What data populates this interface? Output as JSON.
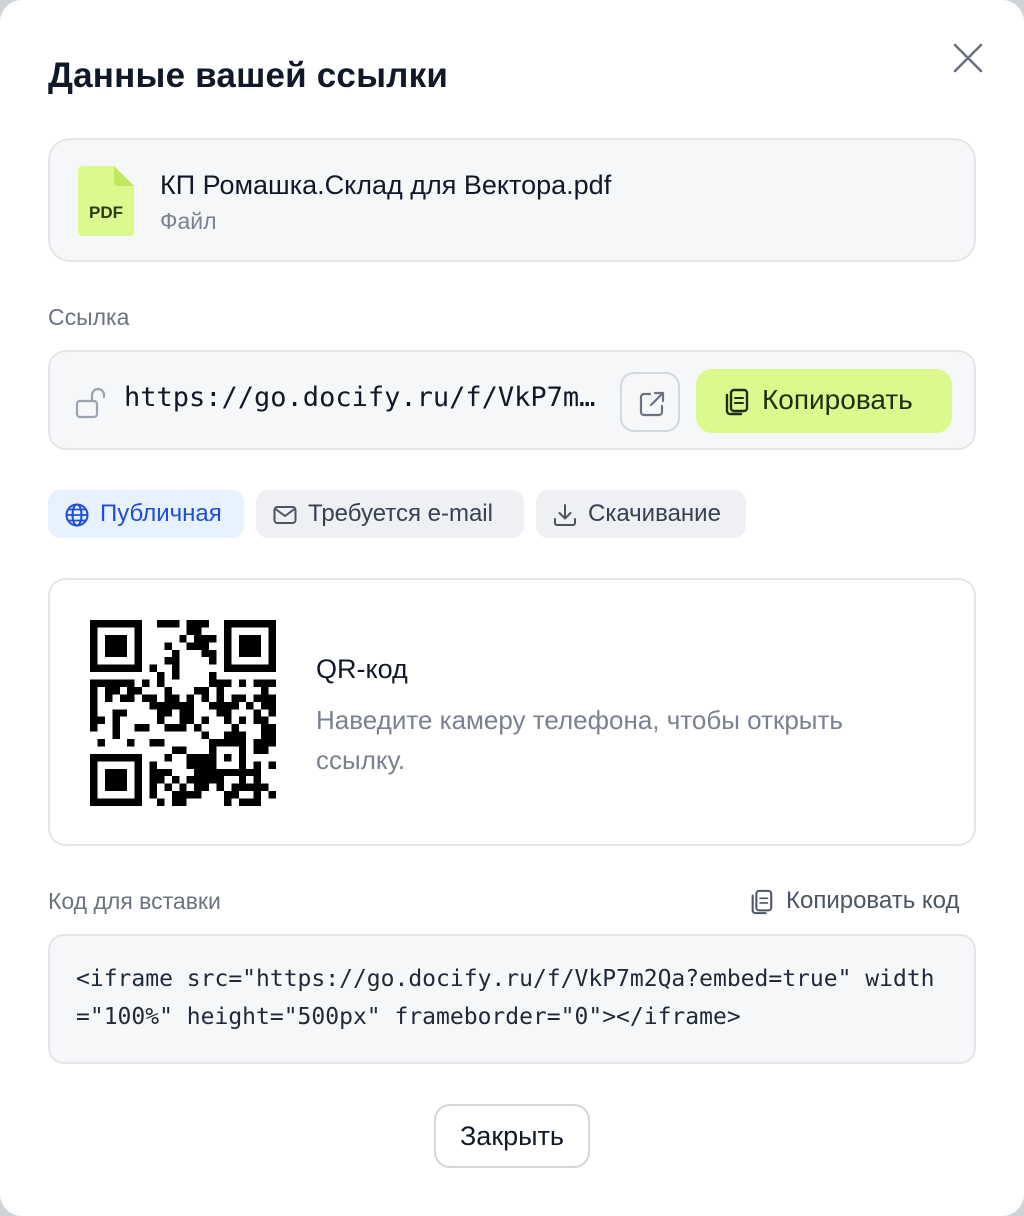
{
  "dialog": {
    "title": "Данные вашей ссылки"
  },
  "file": {
    "name": "КП Ромашка.Склад для Вектора.pdf",
    "type_label": "Файл",
    "icon_text": "PDF",
    "icon_color": "#dcf98e"
  },
  "link": {
    "label": "Ссылка",
    "url": "https://go.docify.ru/f/VkP7m2Qa",
    "copy_label": "Копировать",
    "accent": "#dcf98e"
  },
  "access": {
    "chips": [
      {
        "label": "Публичная",
        "icon": "globe-icon",
        "active": true
      },
      {
        "label": "Требуется e-mail",
        "icon": "mail-icon",
        "active": false
      },
      {
        "label": "Скачивание",
        "icon": "download-icon",
        "active": false
      }
    ]
  },
  "qr": {
    "title": "QR-код",
    "description": "Наведите камеру телефона, чтобы открыть ссылку."
  },
  "embed": {
    "label": "Код для вставки",
    "copy_label": "Копировать код",
    "code": "<iframe src=\"https://go.docify.ru/f/VkP7m2Qa?embed=true\" width=\"100%\" height=\"500px\" frameborder=\"0\"></iframe>"
  },
  "footer": {
    "close_label": "Закрыть"
  }
}
